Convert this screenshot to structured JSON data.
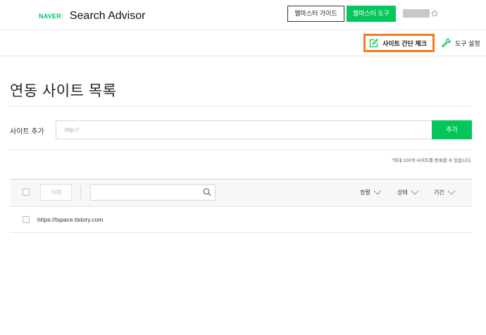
{
  "header": {
    "logo_naver": "NAVER",
    "brand": "Search Advisor",
    "guide_label": "웹마스터 가이드",
    "tools_label": "웹마스터 도구"
  },
  "toolbar": {
    "quick_check_label": "사이트 간단 체크",
    "settings_label": "도구 설정"
  },
  "main": {
    "title": "연동 사이트 목록",
    "add_site_label": "사이트 추가",
    "url_placeholder": "http://",
    "add_button": "추가",
    "limit_note": "*최대 100개 사이트를 등록할 수 있습니다."
  },
  "list": {
    "delete_label": "삭제",
    "sort_options": [
      "정렬",
      "상태",
      "기간"
    ],
    "rows": [
      {
        "url": "https://tspace.tistory.com"
      }
    ]
  },
  "colors": {
    "accent": "#03c75a",
    "highlight": "#f47a1f"
  }
}
